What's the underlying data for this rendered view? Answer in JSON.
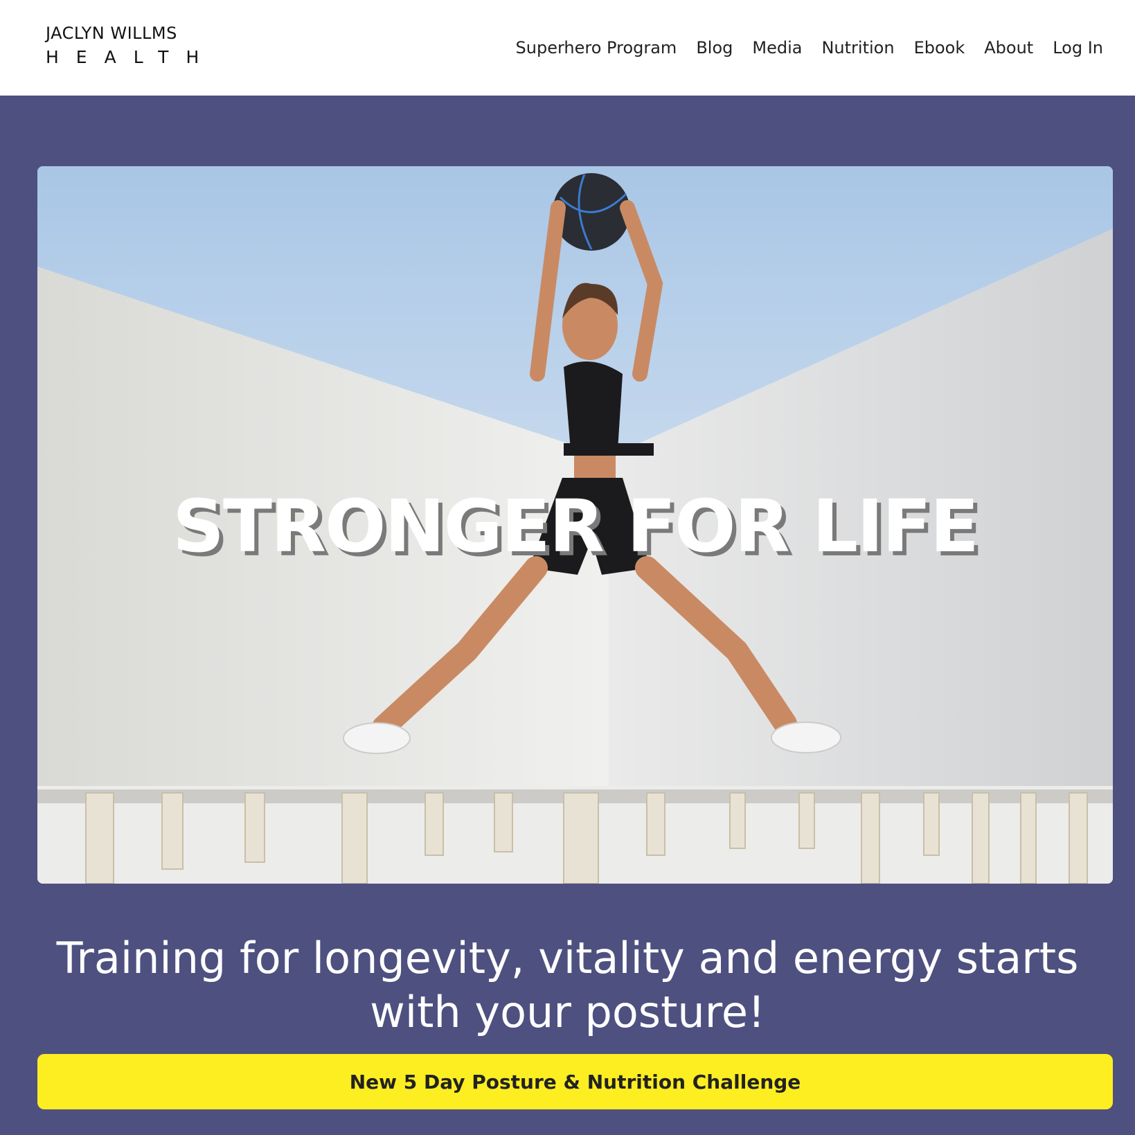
{
  "brand": {
    "line1": "JACLYN WILLMS",
    "line2": "HEALTH"
  },
  "nav": {
    "items": [
      {
        "label": "Superhero Program"
      },
      {
        "label": "Blog"
      },
      {
        "label": "Media"
      },
      {
        "label": "Nutrition"
      },
      {
        "label": "Ebook"
      },
      {
        "label": "About"
      },
      {
        "label": "Log In"
      }
    ]
  },
  "hero": {
    "title": "STRONGER FOR LIFE",
    "image_description": "woman-jumping-with-medicine-ball"
  },
  "tagline": "Training for longevity, vitality and energy starts with your posture!",
  "cta": {
    "label": "New 5 Day Posture & Nutrition Challenge"
  },
  "colors": {
    "band": "#4e5080",
    "cta": "#fcee21",
    "text_dark": "#222222"
  }
}
